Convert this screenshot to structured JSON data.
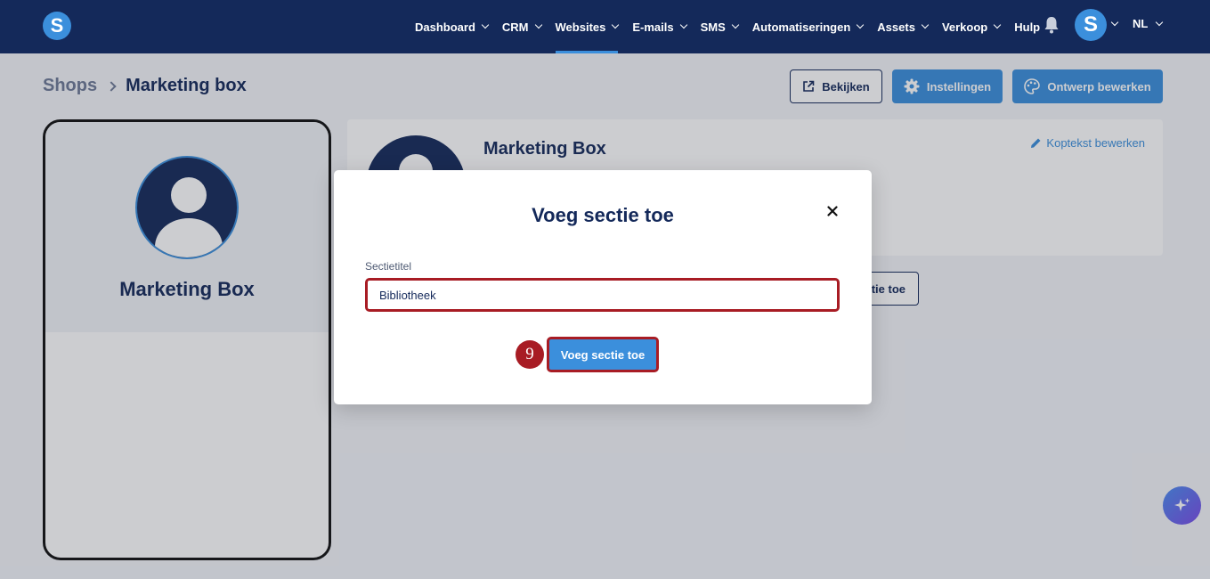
{
  "app": {
    "logo_letter": "S"
  },
  "nav": {
    "items": [
      {
        "label": "Dashboard",
        "has_dropdown": true,
        "active": false
      },
      {
        "label": "CRM",
        "has_dropdown": true,
        "active": false
      },
      {
        "label": "Websites",
        "has_dropdown": true,
        "active": true
      },
      {
        "label": "E-mails",
        "has_dropdown": true,
        "active": false
      },
      {
        "label": "SMS",
        "has_dropdown": true,
        "active": false
      },
      {
        "label": "Automatiseringen",
        "has_dropdown": true,
        "active": false
      },
      {
        "label": "Assets",
        "has_dropdown": true,
        "active": false
      },
      {
        "label": "Verkoop",
        "has_dropdown": true,
        "active": false
      },
      {
        "label": "Hulp",
        "has_dropdown": false,
        "active": false
      }
    ],
    "avatar_letter": "S",
    "language": "NL"
  },
  "breadcrumb": {
    "parent": "Shops",
    "current": "Marketing box"
  },
  "toolbar": {
    "view_label": "Bekijken",
    "settings_label": "Instellingen",
    "design_label": "Ontwerp bewerken"
  },
  "preview": {
    "title": "Marketing Box"
  },
  "card": {
    "title": "Marketing Box",
    "edit_header_label": "Koptekst bewerken"
  },
  "background_add_button": {
    "label_fragment": "tie toe"
  },
  "modal": {
    "title": "Voeg sectie toe",
    "field_label": "Sectietitel",
    "field_value": "Bibliotheek",
    "submit_label": "Voeg sectie toe",
    "step_number": "9"
  },
  "colors": {
    "navy": "#14295a",
    "accent_blue": "#3b8fdc",
    "highlight_red": "#a81c24"
  },
  "icons": [
    "bell-icon",
    "external-link-icon",
    "gear-icon",
    "palette-icon",
    "pencil-icon",
    "close-icon",
    "sparkle-icon",
    "user-silhouette-icon"
  ]
}
